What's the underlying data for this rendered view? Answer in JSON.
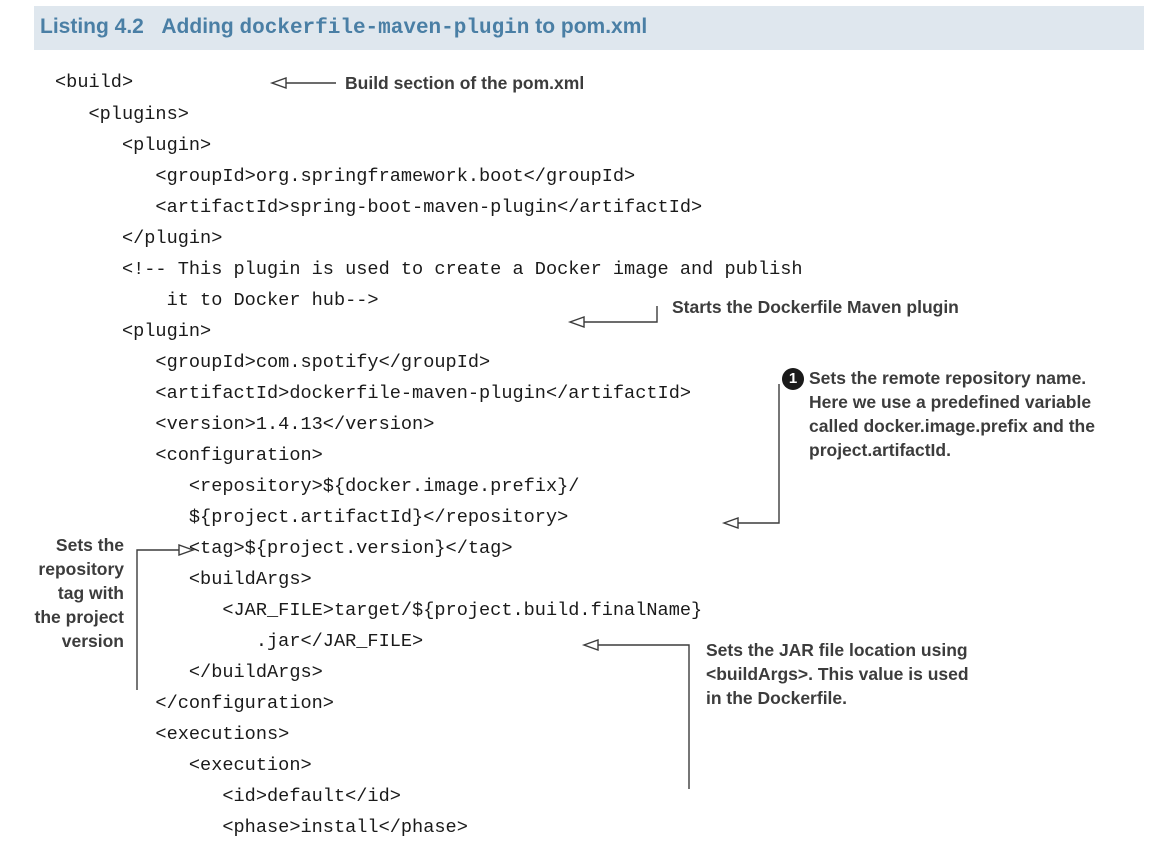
{
  "listing": {
    "label": "Listing 4.2",
    "title_pre": "Adding ",
    "title_code": "dockerfile-maven-plugin",
    "title_post": " to pom.xml"
  },
  "code_lines": [
    "<build>",
    "   <plugins>",
    "      <plugin>",
    "         <groupId>org.springframework.boot</groupId>",
    "         <artifactId>spring-boot-maven-plugin</artifactId>",
    "      </plugin>",
    "      <!-- This plugin is used to create a Docker image and publish",
    "          it to Docker hub-->",
    "      <plugin>",
    "         <groupId>com.spotify</groupId>",
    "         <artifactId>dockerfile-maven-plugin</artifactId>",
    "         <version>1.4.13</version>",
    "         <configuration>",
    "            <repository>${docker.image.prefix}/",
    "            ${project.artifactId}</repository>",
    "            <tag>${project.version}</tag>",
    "            <buildArgs>",
    "               <JAR_FILE>target/${project.build.finalName}",
    "                  .jar</JAR_FILE>",
    "            </buildArgs>",
    "         </configuration>",
    "         <executions>",
    "            <execution>",
    "               <id>default</id>",
    "               <phase>install</phase>"
  ],
  "annotations": {
    "build_section": "Build section of the pom.xml",
    "starts_plugin": "Starts the Dockerfile Maven plugin",
    "callout_number": "1",
    "repository_name": [
      "Sets the remote repository name.",
      "Here we use a predefined variable",
      "called docker.image.prefix and the",
      "project.artifactId."
    ],
    "repository_tag": [
      "Sets the",
      "repository",
      "tag with",
      "the project",
      "version"
    ],
    "jar_location": [
      "Sets the JAR file location using",
      "<buildArgs>. This value is used",
      "in the Dockerfile."
    ]
  },
  "colors": {
    "header_bg": "#dfe7ee",
    "header_text": "#4a7fa5",
    "code_text": "#1a1a1a",
    "annotation_text": "#3c3c3c"
  }
}
